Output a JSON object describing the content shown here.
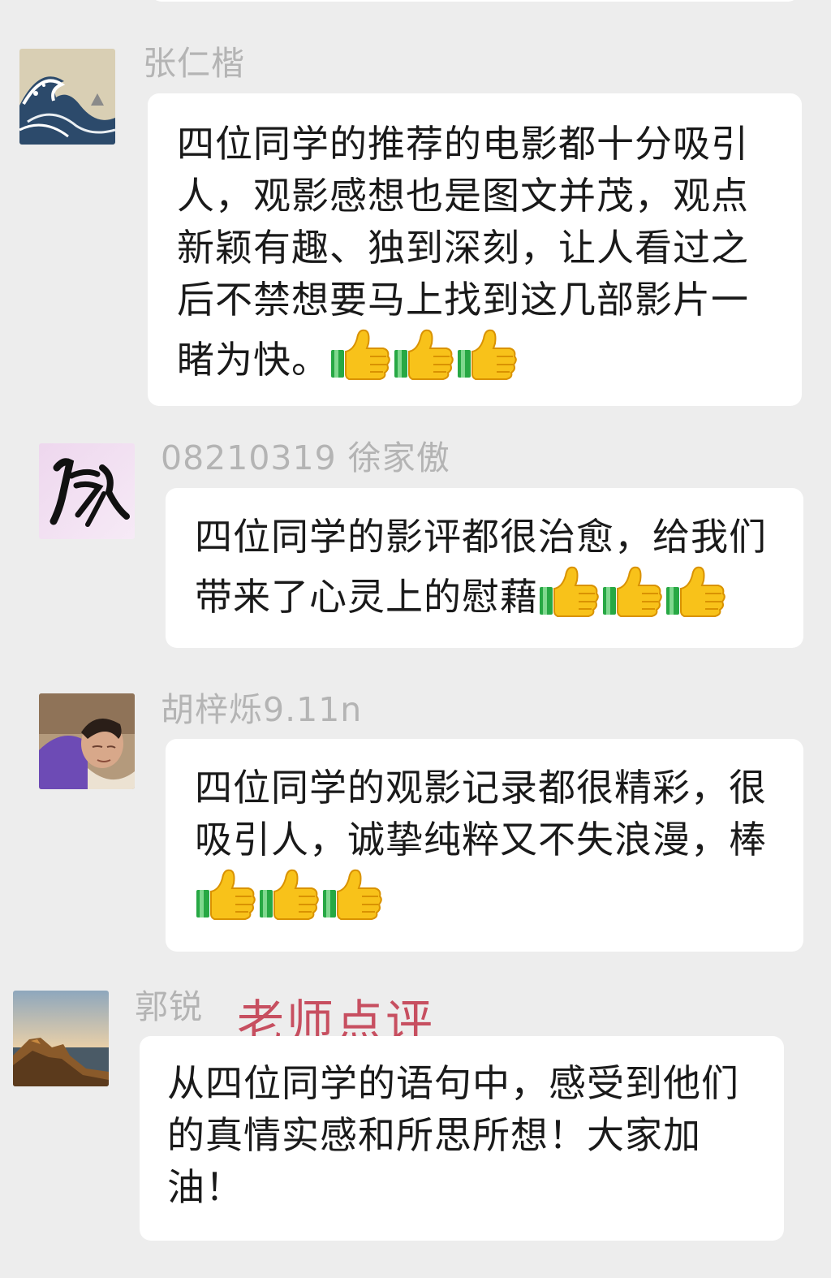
{
  "messages": [
    {
      "sender": "张仁楷",
      "text": "四位同学的推荐的电影都十分吸引人，观影感想也是图文并茂，观点新颖有趣、独到深刻，让人看过之后不禁想要马上找到这几部影片一睹为快。",
      "emoji": [
        "thumbs-up",
        "thumbs-up",
        "thumbs-up"
      ]
    },
    {
      "sender": "08210319 徐家傲",
      "text": "四位同学的影评都很治愈，给我们带来了心灵上的慰藉",
      "emoji": [
        "thumbs-up",
        "thumbs-up",
        "thumbs-up"
      ]
    },
    {
      "sender": "胡梓烁9.11n",
      "text": "四位同学的观影记录都很精彩，很吸引人，诚挚纯粹又不失浪漫，棒",
      "emoji": [
        "thumbs-up",
        "thumbs-up",
        "thumbs-up"
      ]
    },
    {
      "sender": "郭锐",
      "tag": "老师点评",
      "text": "从四位同学的语句中，感受到他们的真情实感和所思所想！大家加油！",
      "emoji": []
    }
  ],
  "colors": {
    "background": "#ededed",
    "bubble": "#ffffff",
    "sender_name": "#b4b4b4",
    "teacher_tag": "#c74f60"
  }
}
